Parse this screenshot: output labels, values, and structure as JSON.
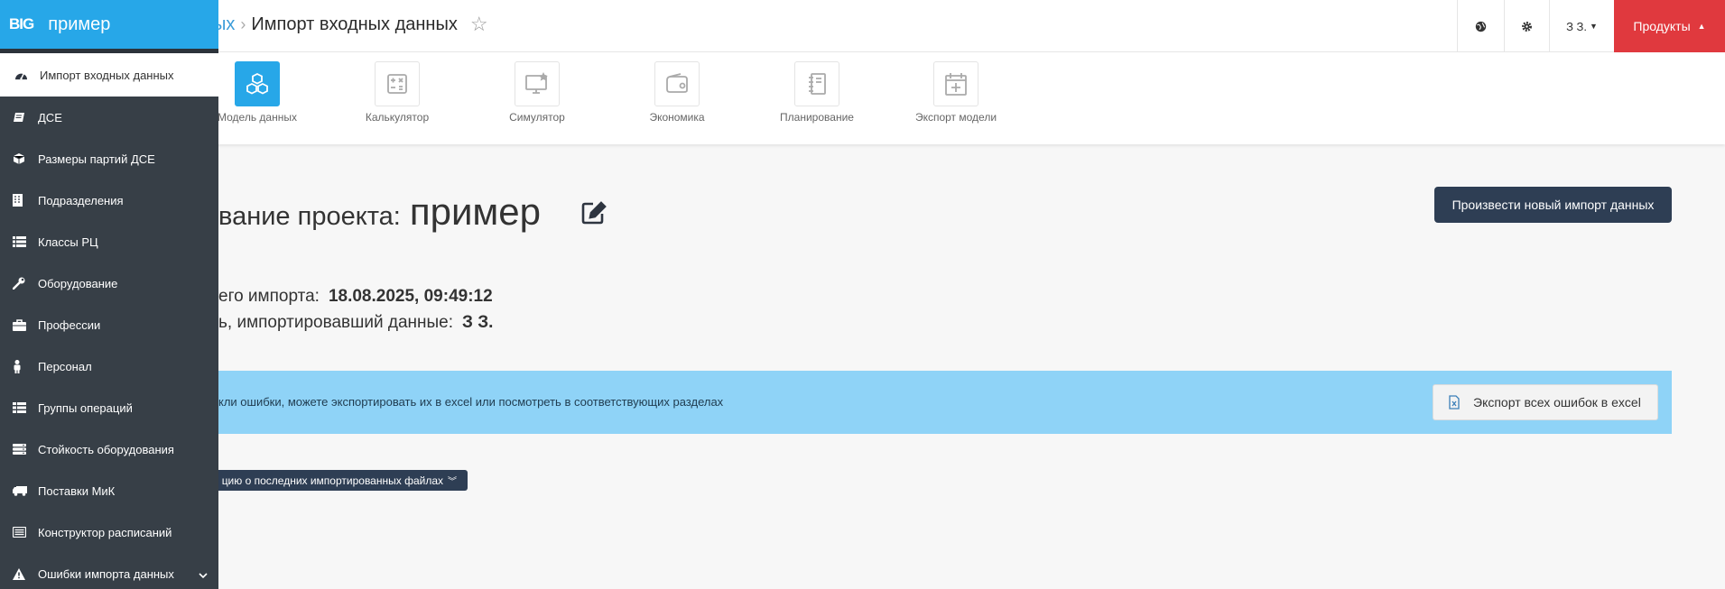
{
  "header": {
    "breadcrumb_prev": "ых",
    "breadcrumb_sep": "›",
    "breadcrumb_current": "Импорт входных данных",
    "user_label": "З З.",
    "products_label": "Продукты"
  },
  "modules": [
    {
      "label": "Модель данных",
      "icon": "cubes-icon",
      "active": true
    },
    {
      "label": "Калькулятор",
      "icon": "calculator-icon"
    },
    {
      "label": "Симулятор",
      "icon": "monitor-icon"
    },
    {
      "label": "Экономика",
      "icon": "wallet-icon"
    },
    {
      "label": "Планирование",
      "icon": "notebook-icon"
    },
    {
      "label": "Экспорт модели",
      "icon": "calendar-plus-icon"
    }
  ],
  "sidebar": {
    "logo": "BIG",
    "project": "пример",
    "items": [
      {
        "label": "Импорт входных данных",
        "icon": "dashboard-icon"
      },
      {
        "label": "ДСЕ",
        "icon": "book-icon"
      },
      {
        "label": "Размеры партий ДСЕ",
        "icon": "cube-icon"
      },
      {
        "label": "Подразделения",
        "icon": "building-icon"
      },
      {
        "label": "Классы РЦ",
        "icon": "list-icon"
      },
      {
        "label": "Оборудование",
        "icon": "wrench-icon"
      },
      {
        "label": "Профессии",
        "icon": "briefcase-icon"
      },
      {
        "label": "Персонал",
        "icon": "person-icon"
      },
      {
        "label": "Группы операций",
        "icon": "table-icon"
      },
      {
        "label": "Стойкость оборудования",
        "icon": "server-icon"
      },
      {
        "label": "Поставки МиК",
        "icon": "truck-icon"
      },
      {
        "label": "Конструктор расписаний",
        "icon": "calendar-icon"
      },
      {
        "label": "Ошибки импорта данных",
        "icon": "warning-icon"
      }
    ]
  },
  "main": {
    "title_prefix": "вание проекта:",
    "project_name": "пример",
    "new_import_button": "Произвести новый импорт данных",
    "last_import_label": "его импорта:",
    "last_import_value": "18.08.2025, 09:49:12",
    "importer_label": "ь, импортировавший данные:",
    "importer_value": "З З.",
    "alert_text": "кли ошибки, можете экспортировать их в excel или посмотреть в соответствующих разделах",
    "export_errors_button": "Экспорт всех ошибок в excel",
    "files_button": "цию о последних импортированных файлах"
  },
  "colors": {
    "sidebar_bg": "#373f47",
    "accent_blue": "#27a7e8",
    "products_red": "#e0393e",
    "dark_button": "#2e3e54",
    "alert_bg": "#8fd3f7"
  }
}
